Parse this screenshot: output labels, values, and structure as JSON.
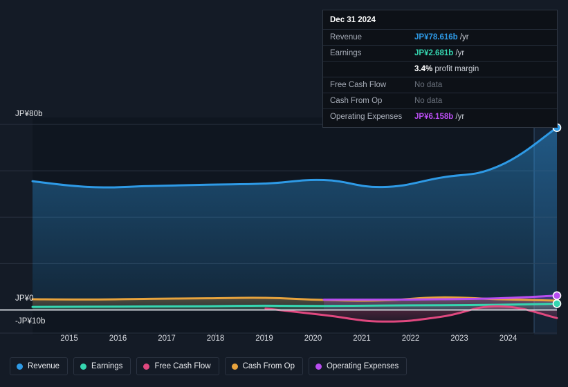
{
  "chart_data": {
    "type": "line",
    "title": "",
    "xlabel": "",
    "ylabel": "",
    "currency": "JP¥",
    "ylim": [
      -10,
      80
    ],
    "y_ticks": [
      {
        "label": "JP¥80b",
        "value": 80
      },
      {
        "label": "JP¥0",
        "value": 0
      },
      {
        "label": "-JP¥10b",
        "value": -10
      }
    ],
    "gridlines": [
      80,
      60,
      40,
      20,
      0,
      -10
    ],
    "grid": true,
    "legend_position": "bottom",
    "x": [
      "2015",
      "2016",
      "2017",
      "2018",
      "2019",
      "2020",
      "2021",
      "2022",
      "2023",
      "2024"
    ],
    "forecast_start": "2024",
    "series": [
      {
        "name": "Revenue",
        "color": "#2e9ae6",
        "values": [
          55.5,
          53.0,
          53.4,
          54.0,
          54.5,
          56.0,
          53.0,
          57.0,
          62.0,
          78.6
        ]
      },
      {
        "name": "Earnings",
        "color": "#35d6b0",
        "values": [
          1.3,
          1.4,
          1.5,
          1.6,
          1.8,
          1.7,
          1.9,
          2.0,
          2.2,
          2.681
        ]
      },
      {
        "name": "Free Cash Flow",
        "color": "#e0487f",
        "values": [
          null,
          null,
          null,
          null,
          0.6,
          -2.2,
          -5.0,
          -3.0,
          1.6,
          -3.5
        ]
      },
      {
        "name": "Cash From Op",
        "color": "#e8a33d",
        "values": [
          4.6,
          4.5,
          4.8,
          5.0,
          5.2,
          4.3,
          4.1,
          5.4,
          4.6,
          4.0
        ]
      },
      {
        "name": "Operating Expenses",
        "color": "#b84df0",
        "values": [
          null,
          null,
          null,
          null,
          null,
          4.4,
          4.4,
          4.6,
          5.0,
          6.158
        ]
      }
    ]
  },
  "y_axis": {
    "top_label": "JP¥80b",
    "zero_label": "JP¥0",
    "bottom_label": "-JP¥10b"
  },
  "x_axis": {
    "ticks": [
      "2015",
      "2016",
      "2017",
      "2018",
      "2019",
      "2020",
      "2021",
      "2022",
      "2023",
      "2024"
    ]
  },
  "tooltip": {
    "date": "Dec 31 2024",
    "rows": [
      {
        "key": "Revenue",
        "value": "JP¥78.616b",
        "unit": " /yr",
        "style": "rev",
        "no_data": false
      },
      {
        "key": "Earnings",
        "value": "JP¥2.681b",
        "unit": " /yr",
        "style": "earn",
        "no_data": false
      },
      {
        "key": "",
        "value": "3.4%",
        "unit": " profit margin",
        "style": "margin",
        "no_data": false
      },
      {
        "key": "Free Cash Flow",
        "value": "No data",
        "unit": "",
        "style": "nodata",
        "no_data": true
      },
      {
        "key": "Cash From Op",
        "value": "No data",
        "unit": "",
        "style": "nodata",
        "no_data": true
      },
      {
        "key": "Operating Expenses",
        "value": "JP¥6.158b",
        "unit": " /yr",
        "style": "opex",
        "no_data": false
      }
    ]
  },
  "legend": {
    "items": [
      {
        "label": "Revenue",
        "color": "#2e9ae6"
      },
      {
        "label": "Earnings",
        "color": "#35d6b0"
      },
      {
        "label": "Free Cash Flow",
        "color": "#e0487f"
      },
      {
        "label": "Cash From Op",
        "color": "#e8a33d"
      },
      {
        "label": "Operating Expenses",
        "color": "#b84df0"
      }
    ]
  },
  "colors": {
    "background": "#141b26",
    "plot_background": "#0f1620",
    "forecast_background": "#152234",
    "gridline": "#2a3240",
    "zero_line": "#c9cdd4"
  }
}
